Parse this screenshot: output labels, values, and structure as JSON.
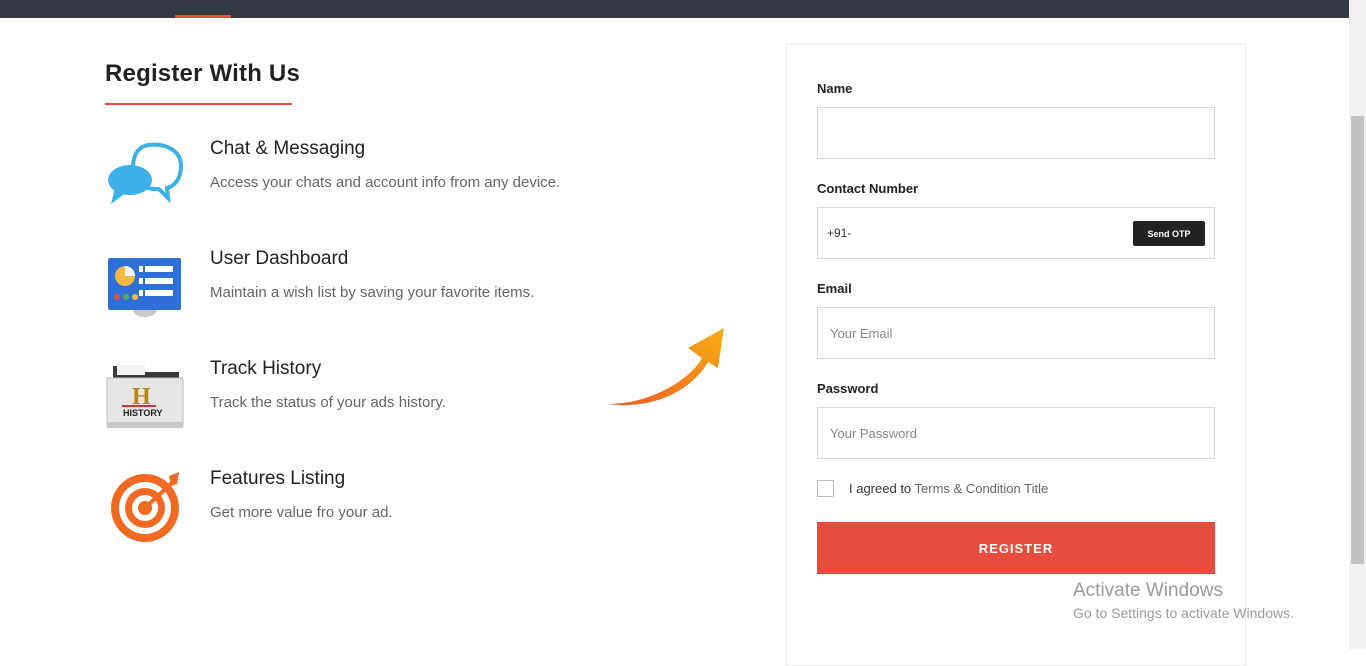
{
  "section": {
    "title": "Register With Us"
  },
  "features": [
    {
      "icon": "chat-bubbles-icon",
      "title": "Chat & Messaging",
      "description": "Access your chats and account info from any device."
    },
    {
      "icon": "dashboard-icon",
      "title": "User Dashboard",
      "description": "Maintain a wish list by saving your favorite items."
    },
    {
      "icon": "history-folder-icon",
      "title": "Track History",
      "description": "Track the status of your ads history.",
      "icon_text": "HISTORY"
    },
    {
      "icon": "target-icon",
      "title": "Features Listing",
      "description": "Get more value fro your ad."
    }
  ],
  "form": {
    "name_label": "Name",
    "name_value": "",
    "contact_label": "Contact Number",
    "contact_value": "+91-",
    "send_otp_label": "Send OTP",
    "email_label": "Email",
    "email_placeholder": "Your Email",
    "password_label": "Password",
    "password_placeholder": "Your Password",
    "agree_text": "I agreed to",
    "terms_text": "Terms & Condition Title",
    "register_label": "REGISTER"
  },
  "watermark": {
    "title": "Activate Windows",
    "subtitle": "Go to Settings to activate Windows."
  },
  "colors": {
    "accent": "#e84c3d",
    "topbar": "#363a45",
    "otp_button": "#222222"
  }
}
